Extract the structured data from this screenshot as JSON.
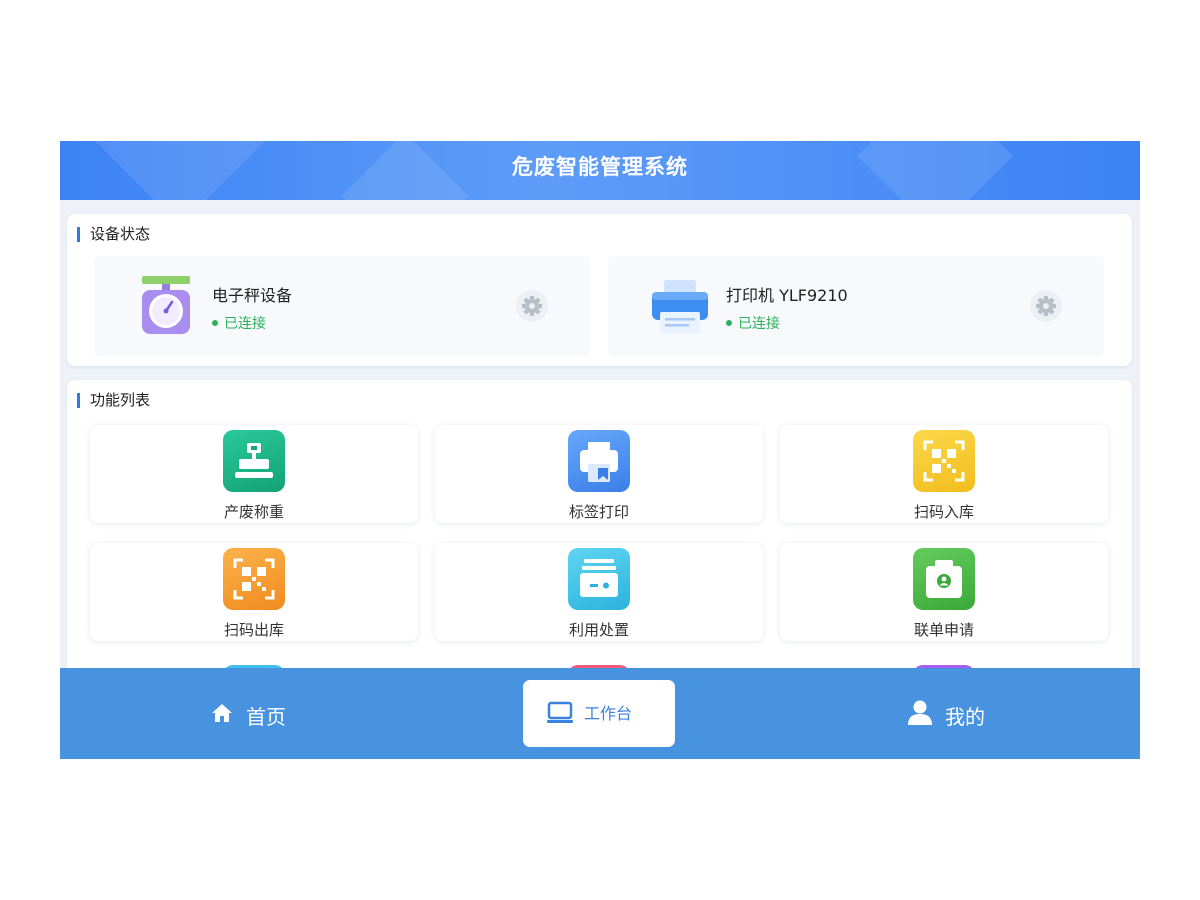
{
  "app": {
    "title": "危废智能管理系统"
  },
  "colors": {
    "primary": "#3b82f4",
    "tabbar": "#4793e0",
    "connected": "#2eb05a"
  },
  "devices": {
    "section_title": "设备状态",
    "items": [
      {
        "name": "电子秤设备",
        "status": "已连接",
        "icon": "scale-icon"
      },
      {
        "name": "打印机 YLF9210",
        "status": "已连接",
        "icon": "printer-icon"
      }
    ]
  },
  "functions": {
    "section_title": "功能列表",
    "items": [
      {
        "label": "产废称重",
        "icon": "weigh-icon",
        "color": "#1fb886"
      },
      {
        "label": "标签打印",
        "icon": "label-print-icon",
        "color": "#4a8ff2"
      },
      {
        "label": "扫码入库",
        "icon": "scan-in-icon",
        "color": "#f4c92e"
      },
      {
        "label": "扫码出库",
        "icon": "scan-out-icon",
        "color": "#f5a133"
      },
      {
        "label": "利用处置",
        "icon": "disposal-icon",
        "color": "#3dc4e8"
      },
      {
        "label": "联单申请",
        "icon": "manifest-icon",
        "color": "#47b94a"
      }
    ]
  },
  "tabs": [
    {
      "label": "首页",
      "icon": "home-icon",
      "active": false
    },
    {
      "label": "工作台",
      "icon": "monitor-icon",
      "active": true
    },
    {
      "label": "我的",
      "icon": "user-icon",
      "active": false
    }
  ]
}
